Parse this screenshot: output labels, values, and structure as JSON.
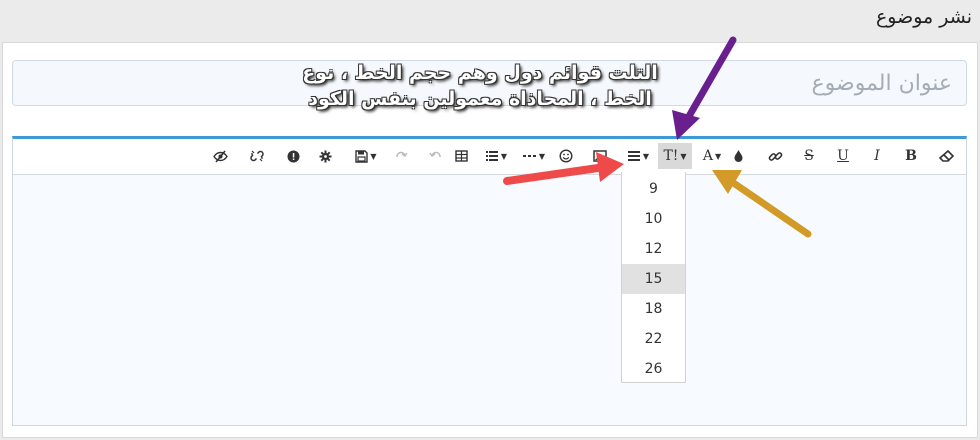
{
  "page": {
    "title": "نشر موضوع"
  },
  "form": {
    "subject_placeholder": "عنوان الموضوع"
  },
  "annotation": {
    "text": "التلت قوائم دول وهم حجم الخط ، نوع الخط ، المحاذاة معمولين بنفس الكود",
    "colors": {
      "purple": "#6a1f8f",
      "red": "#ef4a4a",
      "gold": "#d39a27"
    }
  },
  "toolbar": {
    "accent": "#3c9ad6",
    "buttons": {
      "eraser": "eraser-icon",
      "bold": "B",
      "italic": "I",
      "underline": "U",
      "strike": "S",
      "link": "link-icon",
      "color": "droplet-icon",
      "font": "A",
      "size": "T!",
      "align": "align-icon",
      "image": "image-icon",
      "emoji": "smiley-icon",
      "hr": "dots-icon",
      "list": "list-icon",
      "table": "table-icon",
      "undo": "undo-icon",
      "redo": "redo-icon",
      "save": "save-icon",
      "settings": "gear-icon",
      "alert": "alert-icon",
      "unlink": "unlink-icon",
      "preview": "eye-slash-icon"
    }
  },
  "font_size_dropdown": {
    "options": [
      "9",
      "10",
      "12",
      "15",
      "18",
      "22",
      "26"
    ],
    "selected": "15"
  }
}
